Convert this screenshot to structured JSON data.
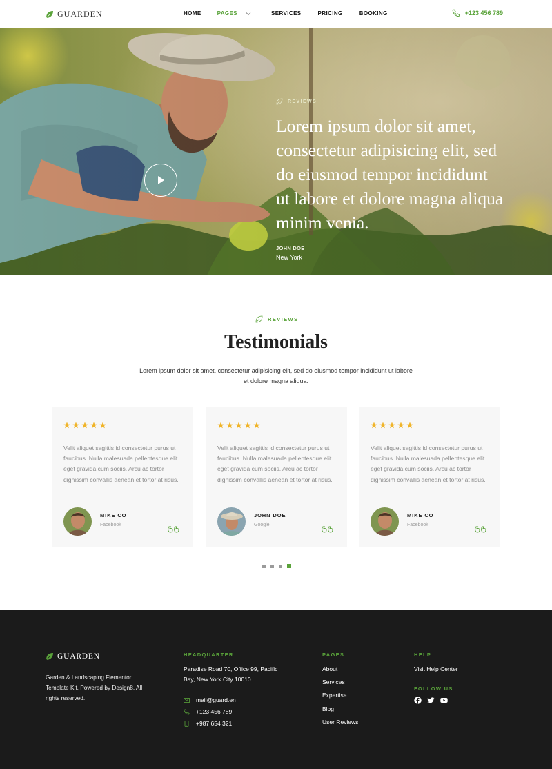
{
  "header": {
    "logo": "GUARDEN",
    "nav": [
      "HOME",
      "PAGES",
      "SERVICES",
      "PRICING",
      "BOOKING"
    ],
    "active_nav": "PAGES",
    "phone": "+123 456 789"
  },
  "hero": {
    "tag": "REVIEWS",
    "quote": "Lorem ipsum dolor sit amet, consectetur adipisicing elit, sed do eiusmod tempor incididunt ut labore et dolore magna aliqua minim venia.",
    "author": "JOHN DOE",
    "location": "New York"
  },
  "testimonials": {
    "tag": "REVIEWS",
    "title": "Testimonials",
    "description": "Lorem ipsum dolor sit amet, consectetur adipisicing elit, sed do eiusmod tempor incididunt ut labore et dolore magna aliqua.",
    "cards": [
      {
        "rating": 5,
        "text": "Velit aliquet sagittis id consectetur purus ut faucibus. Nulla malesuada pellentesque elit eget gravida cum sociis. Arcu ac tortor dignissim convallis aenean et tortor at risus.",
        "name": "MIKE CO",
        "source": "Facebook"
      },
      {
        "rating": 5,
        "text": "Velit aliquet sagittis id consectetur purus ut faucibus. Nulla malesuada pellentesque elit eget gravida cum sociis. Arcu ac tortor dignissim convallis aenean et tortor at risus.",
        "name": "JOHN DOE",
        "source": "Google"
      },
      {
        "rating": 5,
        "text": "Velit aliquet sagittis id consectetur purus ut faucibus. Nulla malesuada pellentesque elit eget gravida cum sociis. Arcu ac tortor dignissim convallis aenean et tortor at risus.",
        "name": "MIKE CO",
        "source": "Facebook"
      }
    ],
    "pagination": {
      "pages": 4,
      "active": 4
    }
  },
  "footer": {
    "logo": "GUARDEN",
    "about": "Garden & Landscaping Flementor Template Kit. Powered by Design8. All rights reserved.",
    "hq_heading": "HEADQUARTER",
    "address": "Paradise Road 70, Office 99, Pacific Bay,  New York City 10010",
    "email": "mail@guard.en",
    "phone1": "+123 456 789",
    "phone2": "+987 654 321",
    "pages_heading": "PAGES",
    "pages": [
      "About",
      "Services",
      "Expertise",
      "Blog",
      "User Reviews"
    ],
    "help_heading": "HELP",
    "help_link": "Visit Help Center",
    "follow_heading": "FOLLOW US",
    "socials": [
      "facebook-icon",
      "twitter-icon",
      "youtube-icon"
    ]
  },
  "colors": {
    "accent": "#5aa33a",
    "star": "#f0b429",
    "footer_bg": "#1b1b1b",
    "card_bg": "#f7f7f7"
  }
}
